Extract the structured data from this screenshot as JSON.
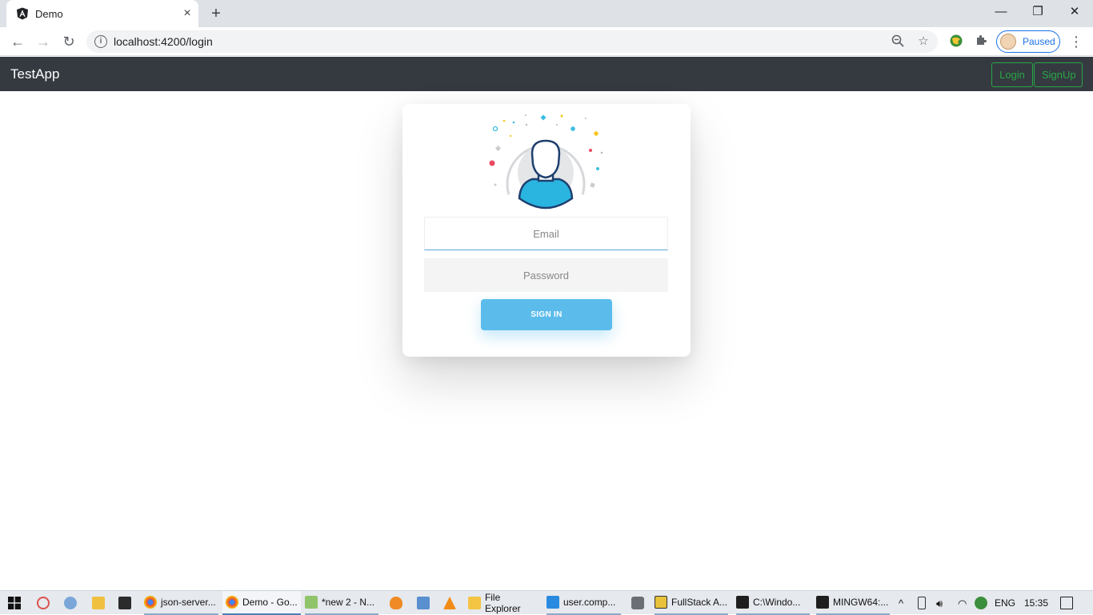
{
  "browser": {
    "tab_title": "Demo",
    "url": "localhost:4200/login",
    "profile_status": "Paused",
    "window_controls": {
      "minimize": "—",
      "restore": "❐",
      "close": "✕"
    }
  },
  "app": {
    "brand": "TestApp",
    "nav": {
      "login_label": "Login",
      "signup_label": "SignUp"
    }
  },
  "login_form": {
    "email_placeholder": "Email",
    "password_placeholder": "Password",
    "signin_label": "SIGN IN"
  },
  "taskbar": {
    "items": [
      {
        "label": "json-server..."
      },
      {
        "label": "Demo - Go..."
      },
      {
        "label": "*new 2 - N..."
      },
      {
        "label": "File Explorer"
      },
      {
        "label": "user.comp..."
      },
      {
        "label": "FullStack A..."
      },
      {
        "label": "C:\\Windo..."
      },
      {
        "label": "MINGW64:..."
      }
    ],
    "language": "ENG",
    "time": "15:35"
  },
  "colors": {
    "navbar_bg": "#343a40",
    "nav_button": "#28a745",
    "signin_bg": "#5bbcec",
    "email_focus": "#5ba8d6"
  }
}
